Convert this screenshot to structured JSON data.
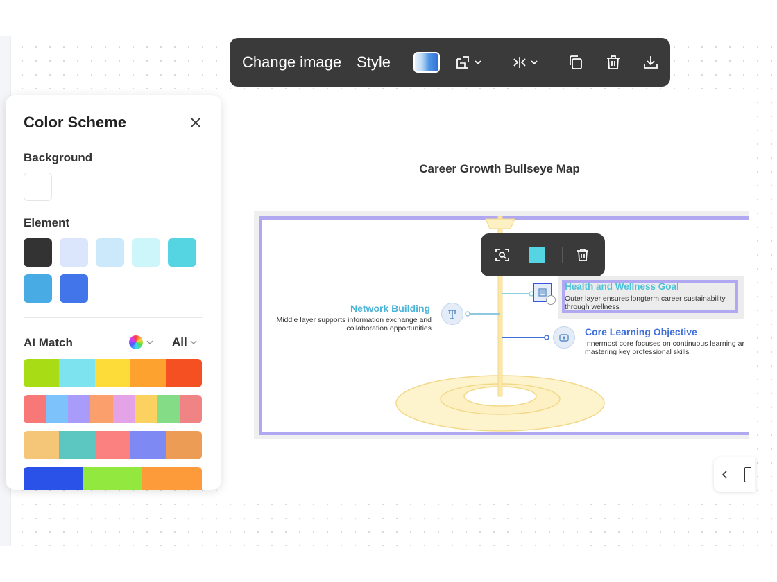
{
  "toolbar": {
    "change_image": "Change image",
    "style": "Style",
    "icons": [
      "gradient-swatch-icon",
      "crop-icon",
      "flip-icon",
      "copy-icon",
      "delete-icon",
      "download-icon"
    ]
  },
  "panel": {
    "title": "Color Scheme",
    "background_label": "Background",
    "background_color": "#ffffff",
    "element_label": "Element",
    "element_colors": [
      "#333333",
      "#dbe5fb",
      "#cce8fb",
      "#cdf6fb",
      "#55d4e2",
      "#49abe3",
      "#4275ea"
    ],
    "ai_match_label": "AI Match",
    "all_label": "All",
    "palettes": [
      [
        "#a8dd15",
        "#7de3ee",
        "#fddb38",
        "#fea22f",
        "#f55022"
      ],
      [
        "#f87878",
        "#7dc2fb",
        "#a89bf9",
        "#fba06c",
        "#e3a3e6",
        "#fbd160",
        "#84dc86",
        "#f08384"
      ],
      [
        "#f5c578",
        "#5cc6c0",
        "#fb8080",
        "#7f89f4",
        "#ed9c56"
      ],
      [
        "#2b52e8",
        "#93e840",
        "#fd9b3a"
      ]
    ]
  },
  "slide": {
    "title": "Career Growth Bullseye Map"
  },
  "diagram": {
    "health_title": "Health and Wellness Goal",
    "health_desc_1": "Outer layer ensures longterm career sustainability",
    "health_desc_2": "through wellness",
    "network_title": "Network Building",
    "network_desc_1": "Middle layer supports information exchange and",
    "network_desc_2": "collaboration opportunities",
    "core_title": "Core Learning Objective",
    "core_desc_1": "Innermost core focuses on continuous learning ar",
    "core_desc_2": "mastering key professional skills",
    "teal": "#4cc2d8",
    "blue": "#3f6fd9"
  },
  "mini_toolbar": {
    "color": "#55d4e2"
  }
}
